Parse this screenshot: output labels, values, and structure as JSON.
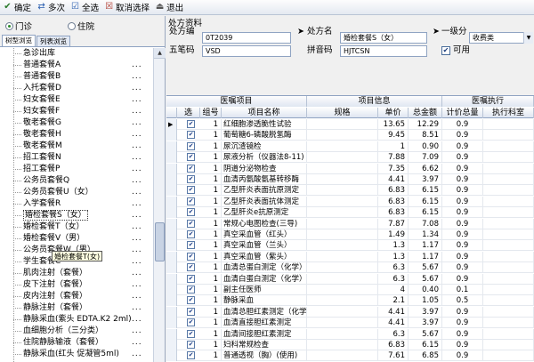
{
  "toolbar": {
    "confirm": "确定",
    "multi": "多次",
    "select_all": "全选",
    "unselect": "取消选择",
    "exit": "退出"
  },
  "left": {
    "radio_outpatient": "门诊",
    "radio_inpatient": "住院",
    "tab_tree": "树型浏览",
    "tab_list": "列表浏览",
    "tooltip": "婚检套餐T(女)",
    "items": [
      {
        "label": "急诊出库",
        "dots": ""
      },
      {
        "label": "普通套餐A",
        "dots": "..."
      },
      {
        "label": "普通套餐B",
        "dots": "..."
      },
      {
        "label": "入托套餐D",
        "dots": "..."
      },
      {
        "label": "妇女套餐E",
        "dots": "..."
      },
      {
        "label": "妇女套餐F",
        "dots": "..."
      },
      {
        "label": "敬老套餐G",
        "dots": "..."
      },
      {
        "label": "敬老套餐H",
        "dots": "..."
      },
      {
        "label": "敬老套餐M",
        "dots": "..."
      },
      {
        "label": "招工套餐N",
        "dots": "..."
      },
      {
        "label": "招工套餐P",
        "dots": "..."
      },
      {
        "label": "公务员套餐Q",
        "dots": "..."
      },
      {
        "label": "公务员套餐U（女）",
        "dots": "..."
      },
      {
        "label": "入学套餐R",
        "dots": "..."
      },
      {
        "label": "婚检套餐S（女）",
        "dots": "..."
      },
      {
        "label": "婚检套餐T（女）",
        "dots": "..."
      },
      {
        "label": "婚检套餐V（男）",
        "dots": "..."
      },
      {
        "label": "公务员套餐W（男）",
        "dots": "..."
      },
      {
        "label": "学生套餐C",
        "dots": "..."
      },
      {
        "label": "肌肉注射（套餐）",
        "dots": "..."
      },
      {
        "label": "皮下注射（套餐）",
        "dots": "..."
      },
      {
        "label": "皮内注射（套餐）",
        "dots": "..."
      },
      {
        "label": "静脉注射（套餐）",
        "dots": "..."
      },
      {
        "label": "静脉采血(紫头 EDTA.K2 2ml)",
        "dots": "..."
      },
      {
        "label": "血细胞分析（三分类）",
        "dots": "..."
      },
      {
        "label": "住院静脉输液（套餐）",
        "dots": "..."
      },
      {
        "label": "静脉采血(红头 促凝管5ml)",
        "dots": "..."
      }
    ]
  },
  "form": {
    "group_title": "处方资料",
    "code_label": "处方编",
    "code_value": "0T2039",
    "name_label": "处方名",
    "name_value": "婚检套餐S（女）",
    "level_label": "一级分",
    "level_value": "收费类",
    "wubi_label": "五笔码",
    "wubi_value": "VSD",
    "pinyin_label": "拼音码",
    "pinyin_value": "HJTCSN",
    "usable_label": "可用",
    "usable_checked": "✔"
  },
  "grid": {
    "band_medical": "医嘱项目",
    "band_info": "项目信息",
    "band_exec": "医嘱执行",
    "col_select": "选",
    "col_group": "组号",
    "col_name": "项目名称",
    "col_spec": "规格",
    "col_price": "单价",
    "col_total": "总金额",
    "col_qty": "计价总量",
    "col_dept": "执行科室",
    "check_mark": "✔",
    "current_indicator": "▶",
    "rows": [
      {
        "group": "1",
        "name": "红细胞渗透脆性试验",
        "price": "13.65",
        "total": "12.29",
        "qty": "0.9"
      },
      {
        "group": "1",
        "name": "葡萄糖6-磷酸脱氢酶",
        "price": "9.45",
        "total": "8.51",
        "qty": "0.9"
      },
      {
        "group": "1",
        "name": "尿沉渣镜检",
        "price": "1",
        "total": "0.90",
        "qty": "0.9"
      },
      {
        "group": "1",
        "name": "尿液分析（仪器法8-11)",
        "price": "7.88",
        "total": "7.09",
        "qty": "0.9"
      },
      {
        "group": "1",
        "name": "阴道分泌物检查",
        "price": "7.35",
        "total": "6.62",
        "qty": "0.9"
      },
      {
        "group": "1",
        "name": "血清丙氨酸氨基转移酶",
        "price": "4.41",
        "total": "3.97",
        "qty": "0.9"
      },
      {
        "group": "1",
        "name": "乙型肝炎表面抗原测定",
        "price": "6.83",
        "total": "6.15",
        "qty": "0.9"
      },
      {
        "group": "1",
        "name": "乙型肝炎表面抗体测定",
        "price": "6.83",
        "total": "6.15",
        "qty": "0.9"
      },
      {
        "group": "1",
        "name": "乙型肝炎e抗原测定",
        "price": "6.83",
        "total": "6.15",
        "qty": "0.9"
      },
      {
        "group": "1",
        "name": "常规心电图检查(三导)",
        "price": "7.87",
        "total": "7.08",
        "qty": "0.9"
      },
      {
        "group": "1",
        "name": "真空采血管（红头）",
        "price": "1.49",
        "total": "1.34",
        "qty": "0.9"
      },
      {
        "group": "1",
        "name": "真空采血管（兰头）",
        "price": "1.3",
        "total": "1.17",
        "qty": "0.9"
      },
      {
        "group": "1",
        "name": "真空采血管（紫头）",
        "price": "1.3",
        "total": "1.17",
        "qty": "0.9"
      },
      {
        "group": "1",
        "name": "血清总蛋白测定（化学）",
        "price": "6.3",
        "total": "5.67",
        "qty": "0.9"
      },
      {
        "group": "1",
        "name": "血清白蛋白测定（化学）",
        "price": "6.3",
        "total": "5.67",
        "qty": "0.9"
      },
      {
        "group": "1",
        "name": "副主任医师",
        "price": "4",
        "total": "0.40",
        "qty": "0.1"
      },
      {
        "group": "1",
        "name": "静脉采血",
        "price": "2.1",
        "total": "1.05",
        "qty": "0.5"
      },
      {
        "group": "1",
        "name": "血清总胆红素测定（化学）",
        "price": "4.41",
        "total": "3.97",
        "qty": "0.9"
      },
      {
        "group": "1",
        "name": "血清直接胆红素测定",
        "price": "4.41",
        "total": "3.97",
        "qty": "0.9"
      },
      {
        "group": "1",
        "name": "血清间接胆红素测定",
        "price": "6.3",
        "total": "5.67",
        "qty": "0.9"
      },
      {
        "group": "1",
        "name": "妇科常规检查",
        "price": "6.83",
        "total": "6.15",
        "qty": "0.9"
      },
      {
        "group": "1",
        "name": "普通透视（胸）(使用)",
        "price": "7.61",
        "total": "6.85",
        "qty": "0.9"
      }
    ]
  },
  "colors": {
    "toolbar_bg": "#e4e9f1",
    "header_bg": "#dfe6f1",
    "check_color": "#1d3f88"
  }
}
